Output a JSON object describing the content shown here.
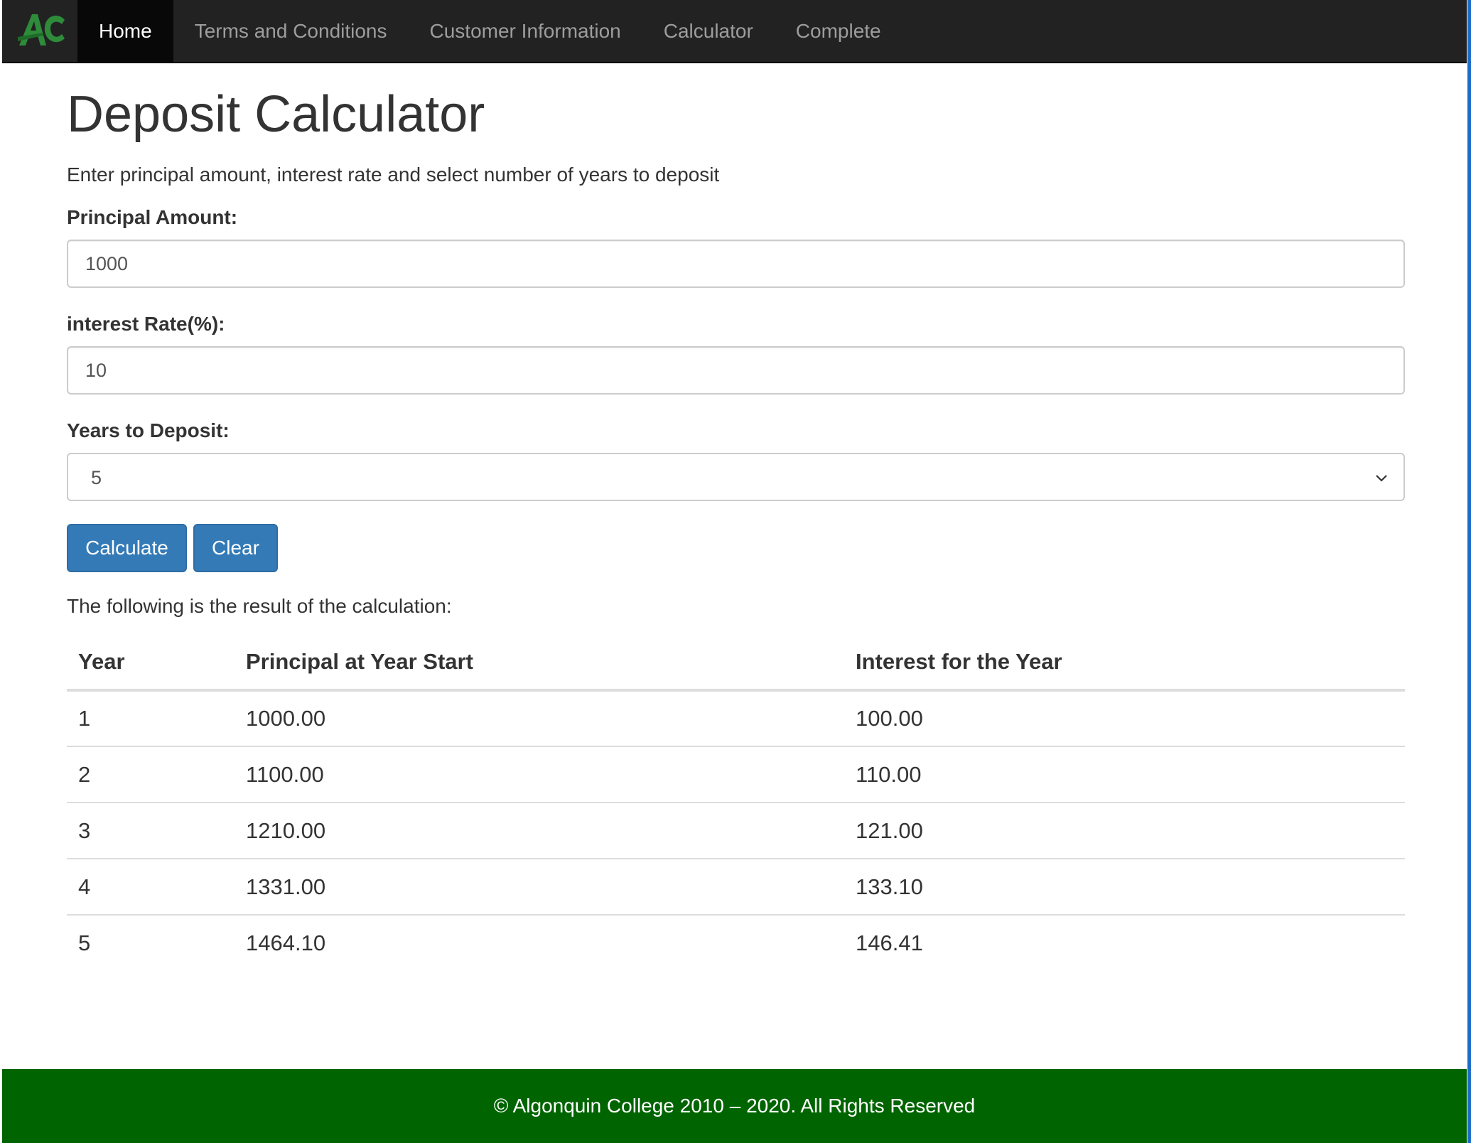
{
  "nav": {
    "brand": "AC",
    "items": [
      {
        "label": "Home",
        "active": true
      },
      {
        "label": "Terms and Conditions",
        "active": false
      },
      {
        "label": "Customer Information",
        "active": false
      },
      {
        "label": "Calculator",
        "active": false
      },
      {
        "label": "Complete",
        "active": false
      }
    ]
  },
  "main": {
    "title": "Deposit Calculator",
    "lead": "Enter principal amount, interest rate and select number of years to deposit",
    "principal": {
      "label": "Principal Amount:",
      "value": "1000"
    },
    "rate": {
      "label": "interest Rate(%):",
      "value": "10"
    },
    "years": {
      "label": "Years to Deposit:",
      "value": "5"
    },
    "calculate_label": "Calculate",
    "clear_label": "Clear",
    "result_text": "The following is the result of the calculation:"
  },
  "results_table": {
    "headers": [
      "Year",
      "Principal at Year Start",
      "Interest for the Year"
    ],
    "rows": [
      [
        "1",
        "1000.00",
        "100.00"
      ],
      [
        "2",
        "1100.00",
        "110.00"
      ],
      [
        "3",
        "1210.00",
        "121.00"
      ],
      [
        "4",
        "1331.00",
        "133.10"
      ],
      [
        "5",
        "1464.10",
        "146.41"
      ]
    ]
  },
  "footer": {
    "text": "© Algonquin College 2010 – 2020. All Rights Reserved"
  },
  "colors": {
    "navbar": "#222222",
    "button": "#337ab7",
    "footer": "#006400",
    "logo": "#2e8b3a"
  }
}
